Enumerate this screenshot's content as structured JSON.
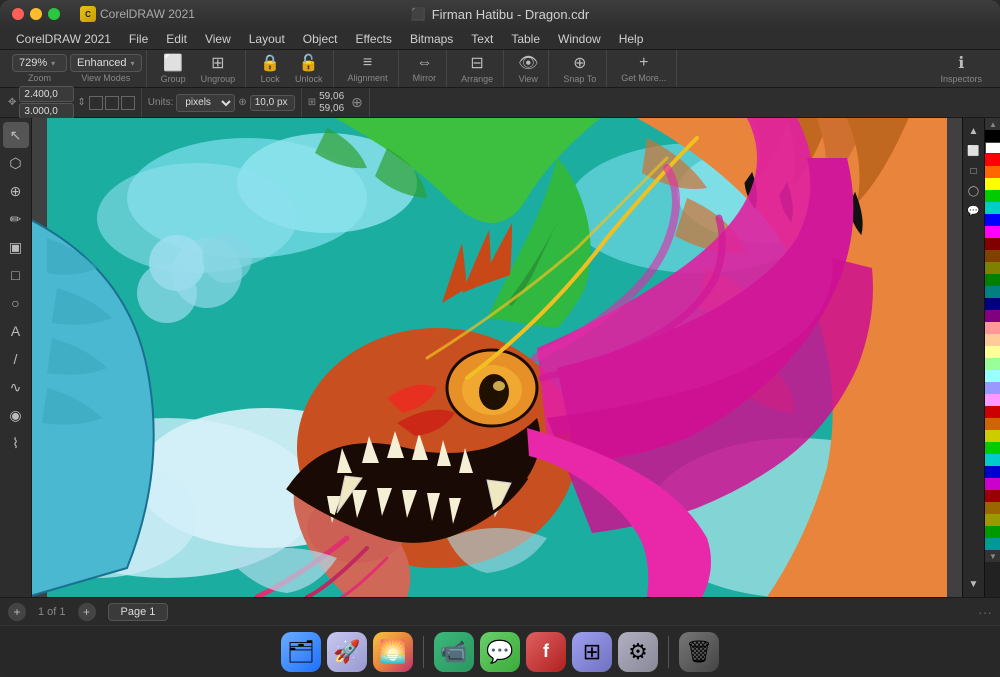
{
  "titleBar": {
    "appName": "CorelDRAW 2021",
    "fileName": "Firman Hatibu - Dragon.cdr",
    "trafficLights": [
      "close",
      "minimize",
      "maximize"
    ]
  },
  "menuBar": {
    "items": [
      "CorelDRAW 2021",
      "File",
      "Edit",
      "View",
      "Layout",
      "Object",
      "Effects",
      "Bitmaps",
      "Text",
      "Table",
      "Window",
      "Help"
    ]
  },
  "toolbar": {
    "zoom": {
      "value": "729%",
      "label": "Zoom"
    },
    "viewMode": {
      "value": "Enhanced",
      "label": "View Modes"
    },
    "group": {
      "label": "Group"
    },
    "ungroup": {
      "label": "Ungroup"
    },
    "lock": {
      "label": "Lock"
    },
    "unlock": {
      "label": "Unlock"
    },
    "alignment": {
      "label": "Alignment"
    },
    "mirror": {
      "label": "Mirror"
    },
    "arrange": {
      "label": "Arrange"
    },
    "view": {
      "label": "View"
    },
    "snapTo": {
      "label": "Snap To"
    },
    "getMore": {
      "label": "Get More..."
    },
    "inspectors": {
      "label": "Inspectors"
    }
  },
  "toolbar2": {
    "xLabel": "↔",
    "xValue": "2.400,0",
    "yValue": "3.000,0",
    "units": "pixels",
    "nudge": "10,0 px",
    "coord1": "59,06",
    "coord2": "59,06",
    "sizeLabel": "Units:"
  },
  "tools": [
    {
      "name": "selection-tool",
      "icon": "↖",
      "active": true
    },
    {
      "name": "node-tool",
      "icon": "⬡"
    },
    {
      "name": "zoom-tool",
      "icon": "⊕"
    },
    {
      "name": "freehand-tool",
      "icon": "✏"
    },
    {
      "name": "smart-fill-tool",
      "icon": "▣"
    },
    {
      "name": "rectangle-tool",
      "icon": "□"
    },
    {
      "name": "ellipse-tool",
      "icon": "○"
    },
    {
      "name": "text-tool",
      "icon": "A"
    },
    {
      "name": "line-tool",
      "icon": "/"
    },
    {
      "name": "curve-tool",
      "icon": "∿"
    },
    {
      "name": "fill-tool",
      "icon": "◉"
    },
    {
      "name": "eyedropper-tool",
      "icon": "⌇"
    }
  ],
  "colorPalette": {
    "colors": [
      "#000000",
      "#ffffff",
      "#ff0000",
      "#ff6600",
      "#ffff00",
      "#00ff00",
      "#00ffff",
      "#0000ff",
      "#ff00ff",
      "#800000",
      "#804000",
      "#808000",
      "#008000",
      "#008080",
      "#000080",
      "#800080",
      "#ff9999",
      "#ffcc99",
      "#ffff99",
      "#99ff99",
      "#99ffff",
      "#9999ff",
      "#ff99ff",
      "#cc0000",
      "#cc6600",
      "#cccc00",
      "#00cc00",
      "#00cccc",
      "#0000cc",
      "#cc00cc",
      "#990000",
      "#996600",
      "#999900",
      "#009900",
      "#009999",
      "#000099",
      "#990099",
      "#660000"
    ]
  },
  "statusBar": {
    "pageInfo": "1 of 1",
    "pageName": "Page 1",
    "addPageBtn": "+",
    "moreDots": "···"
  },
  "dock": {
    "items": [
      {
        "name": "finder",
        "label": "🗂",
        "class": "di-finder"
      },
      {
        "name": "launchpad",
        "label": "🚀",
        "class": "di-launchpad"
      },
      {
        "name": "photos",
        "label": "🌅",
        "class": "di-photos"
      },
      {
        "name": "facetime",
        "label": "📹",
        "class": "di-facetime"
      },
      {
        "name": "messages",
        "label": "💬",
        "class": "di-messages"
      },
      {
        "name": "unknown-app",
        "label": "f",
        "class": "di-launchpad2"
      },
      {
        "name": "launchpad3",
        "label": "⊞",
        "class": "di-launchpad"
      },
      {
        "name": "system-prefs",
        "label": "⚙",
        "class": "di-system"
      },
      {
        "name": "trash",
        "label": "🗑",
        "class": "di-trash"
      }
    ]
  }
}
